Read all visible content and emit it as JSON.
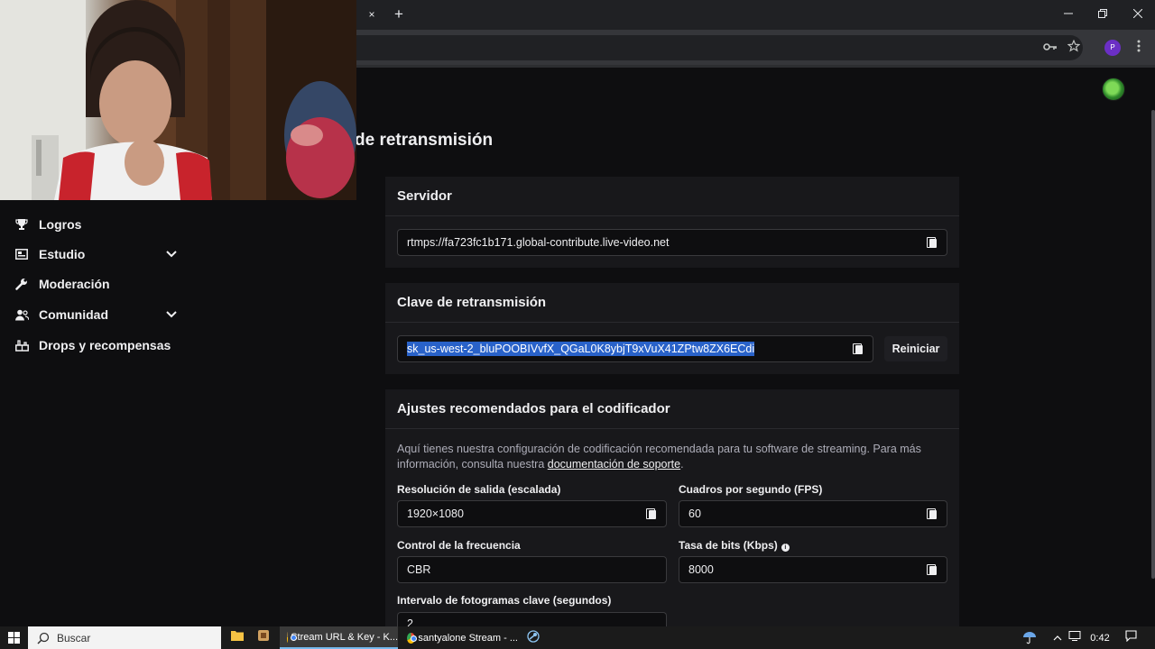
{
  "browser": {
    "tab_close": "×",
    "new_tab": "+",
    "profile_initial": "P"
  },
  "page": {
    "title_fragment": "de retransmisión"
  },
  "sidebar": {
    "items": [
      {
        "label": "Logros",
        "icon": "trophy-icon",
        "expandable": false
      },
      {
        "label": "Estudio",
        "icon": "studio-icon",
        "expandable": true
      },
      {
        "label": "Moderación",
        "icon": "wrench-icon",
        "expandable": false
      },
      {
        "label": "Comunidad",
        "icon": "community-icon",
        "expandable": true
      },
      {
        "label": "Drops y recompensas",
        "icon": "drops-icon",
        "expandable": false
      }
    ]
  },
  "server": {
    "heading": "Servidor",
    "url": "rtmps://fa723fc1b171.global-contribute.live-video.net"
  },
  "stream_key": {
    "heading": "Clave de retransmisión",
    "value": "sk_us-west-2_bluPOOBIVvfX_QGaL0K8ybjT9xVuX41ZPtw8ZX6ECdi",
    "reset_label": "Reiniciar"
  },
  "encoder": {
    "heading": "Ajustes recomendados para el codificador",
    "desc_before": "Aquí tienes nuestra configuración de codificación recomendada para tu software de streaming. Para más información, consulta nuestra ",
    "desc_link": "documentación de soporte",
    "desc_after": ".",
    "resolution_label": "Resolución de salida (escalada)",
    "resolution_value": "1920×1080",
    "fps_label": "Cuadros por segundo (FPS)",
    "fps_value": "60",
    "rate_control_label": "Control de la frecuencia",
    "rate_control_value": "CBR",
    "bitrate_label": "Tasa de bits (Kbps)",
    "bitrate_value": "8000",
    "keyframe_label": "Intervalo de fotogramas clave (segundos)",
    "keyframe_value": "2"
  },
  "taskbar": {
    "search_label": "Buscar",
    "apps": [
      {
        "label": "Stream URL & Key - K...",
        "active": true
      },
      {
        "label": "santyalone Stream - ...",
        "active": false
      }
    ],
    "clock": "0:42"
  },
  "colors": {
    "background": "#0e0e10",
    "card": "#18181b",
    "selection": "#2962c9",
    "profile_purple": "#6b2fc5"
  }
}
